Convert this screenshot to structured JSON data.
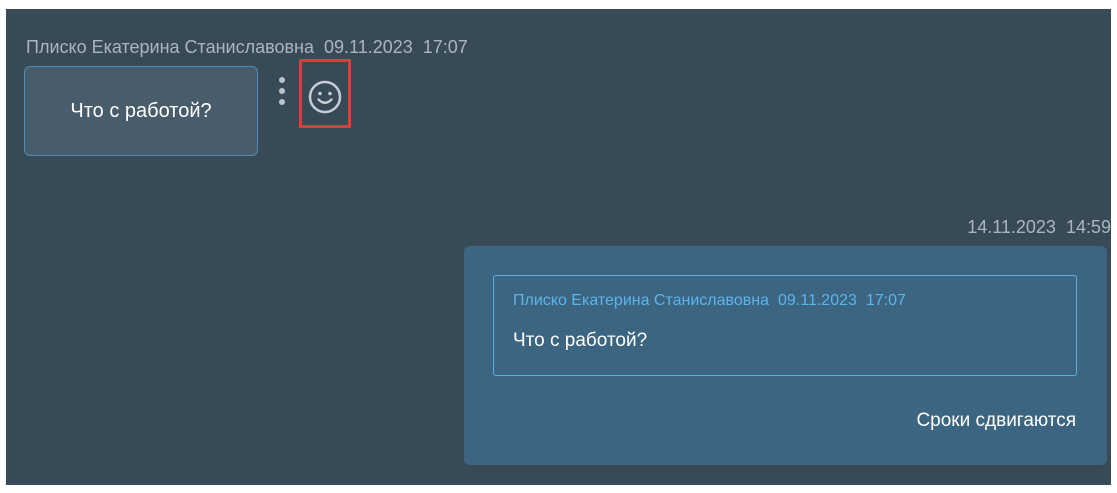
{
  "incoming_message": {
    "sender": "Плиско Екатерина Станиславовна",
    "date": "09.11.2023",
    "time": "17:07",
    "text": "Что с работой?"
  },
  "message_actions": {
    "more_icon": "vertical-dots-icon",
    "emoji_icon": "smiley-icon"
  },
  "outgoing_message": {
    "date": "14.11.2023",
    "time": "14:59",
    "quote": {
      "sender": "Плиско Екатерина Станиславовна",
      "date": "09.11.2023",
      "time": "17:07",
      "text": "Что с работой?"
    },
    "text": "Сроки сдвигаются"
  },
  "colors": {
    "panel_background": "#384a56",
    "incoming_bubble": "#485c6a",
    "outgoing_bubble": "#3c6582",
    "quote_accent": "#5cb4ea",
    "highlight": "#e03a3a"
  }
}
